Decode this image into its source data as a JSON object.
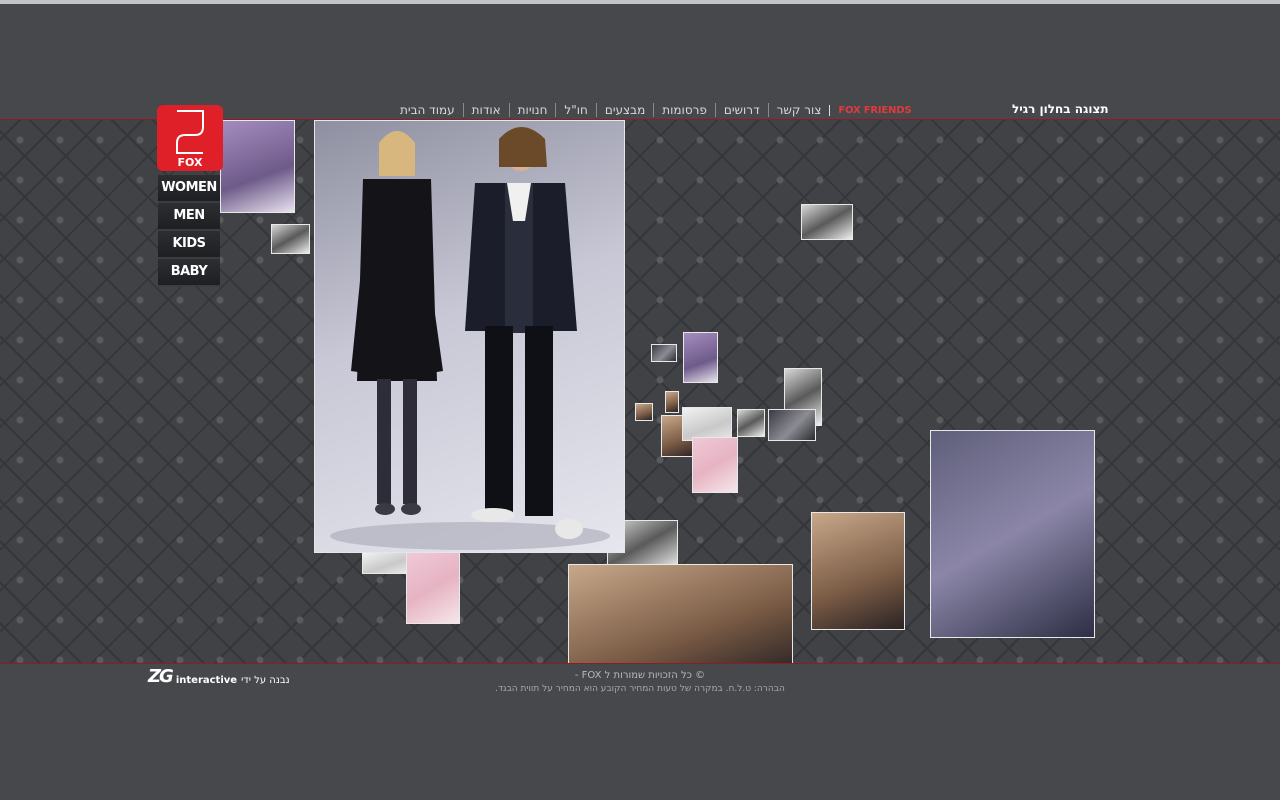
{
  "header": {
    "view_normal": "תצוגה בחלון רגיל",
    "nav": [
      {
        "label": "FOX FRIENDS",
        "kind": "friends"
      },
      {
        "label": "צור קשר"
      },
      {
        "label": "דרושים"
      },
      {
        "label": "פרסומות"
      },
      {
        "label": "מבצעים"
      },
      {
        "label": "חו\"ל"
      },
      {
        "label": "חנויות"
      },
      {
        "label": "אודות"
      },
      {
        "label": "עמוד הבית"
      }
    ]
  },
  "logo": {
    "text": "FOX"
  },
  "categories": [
    "WOMEN",
    "MEN",
    "KIDS",
    "BABY"
  ],
  "colors": {
    "accent": "#e02028",
    "background": "#47484b",
    "divider": "#8e1c22"
  },
  "footer": {
    "copyright": "© כל הזכויות שמורות ל FOX -",
    "disclaimer": "הבהרה: ט.ל.ח. במקרה של טעות המחיר הקובע הוא המחיר על תווית הבגד.",
    "credit_by": "נבנה על ידי",
    "credit_brand_zg": "ZG",
    "credit_brand_rest": "interactive"
  }
}
